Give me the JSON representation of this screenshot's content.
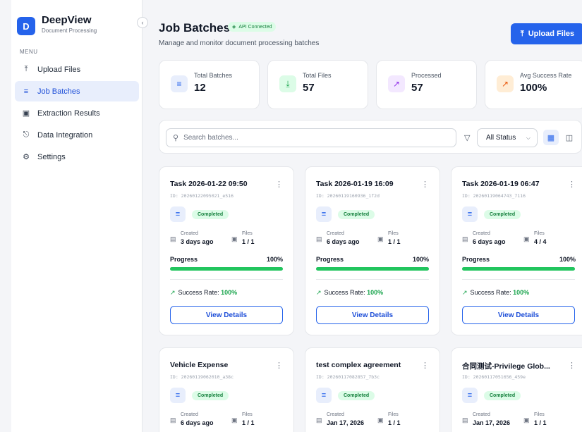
{
  "brand": {
    "logo_letter": "D",
    "title": "DeepView",
    "subtitle": "Document Processing"
  },
  "sidebar": {
    "collapse_icon": "chevron-left-icon",
    "menu_heading": "MENU",
    "items": [
      {
        "label": "Upload Files",
        "icon": "upload-icon",
        "active": false
      },
      {
        "label": "Job Batches",
        "icon": "layers-icon",
        "active": true
      },
      {
        "label": "Extraction Results",
        "icon": "file-icon",
        "active": false
      },
      {
        "label": "Data Integration",
        "icon": "plug-icon",
        "active": false
      },
      {
        "label": "Settings",
        "icon": "gear-icon",
        "active": false
      }
    ]
  },
  "header": {
    "title": "Job Batches",
    "api_status": "API Connected",
    "subtitle": "Manage and monitor document processing batches",
    "upload_label": "Upload Files"
  },
  "stats": [
    {
      "label": "Total Batches",
      "value": "12",
      "icon": "layers-icon",
      "color": "#2563eb",
      "bg": "#e8eefc"
    },
    {
      "label": "Total Files",
      "value": "57",
      "icon": "download-icon",
      "color": "#16a34a",
      "bg": "#dcfce7"
    },
    {
      "label": "Processed",
      "value": "57",
      "icon": "trend-up-icon",
      "color": "#9333ea",
      "bg": "#f3e8ff"
    },
    {
      "label": "Avg Success Rate",
      "value": "100%",
      "icon": "trend-up-icon",
      "color": "#ea580c",
      "bg": "#ffedd5"
    }
  ],
  "filters": {
    "search_placeholder": "Search batches...",
    "status_selected": "All Status",
    "view_modes": [
      "grid-icon",
      "table-icon"
    ]
  },
  "cards": [
    {
      "title": "Task 2026-01-22 09:50",
      "id": "ID: 20260122095021_e516",
      "status": "Completed",
      "created_label": "Created",
      "created": "3 days ago",
      "files_label": "Files",
      "files": "1 / 1",
      "progress_label": "Progress",
      "progress": 100,
      "progress_text": "100%",
      "success_label": "Success Rate:",
      "success": "100%",
      "button": "View Details"
    },
    {
      "title": "Task 2026-01-19 16:09",
      "id": "ID: 20260119160936_1f2d",
      "status": "Completed",
      "created_label": "Created",
      "created": "6 days ago",
      "files_label": "Files",
      "files": "1 / 1",
      "progress_label": "Progress",
      "progress": 100,
      "progress_text": "100%",
      "success_label": "Success Rate:",
      "success": "100%",
      "button": "View Details"
    },
    {
      "title": "Task 2026-01-19 06:47",
      "id": "ID: 20260119064743_7116",
      "status": "Completed",
      "created_label": "Created",
      "created": "6 days ago",
      "files_label": "Files",
      "files": "4 / 4",
      "progress_label": "Progress",
      "progress": 100,
      "progress_text": "100%",
      "success_label": "Success Rate:",
      "success": "100%",
      "button": "View Details"
    },
    {
      "title": "Vehicle Expense",
      "id": "ID: 20260119062010_a38c",
      "status": "Completed",
      "created_label": "Created",
      "created": "6 days ago",
      "files_label": "Files",
      "files": "1 / 1"
    },
    {
      "title": "test complex agreement",
      "id": "ID: 20260117082857_7b3c",
      "status": "Completed",
      "created_label": "Created",
      "created": "Jan 17, 2026",
      "files_label": "Files",
      "files": "1 / 1"
    },
    {
      "title": "合同测试-Privilege Glob...",
      "id": "ID: 20260117051656_459e",
      "status": "Completed",
      "created_label": "Created",
      "created": "Jan 17, 2026",
      "files_label": "Files",
      "files": "1 / 1"
    }
  ]
}
